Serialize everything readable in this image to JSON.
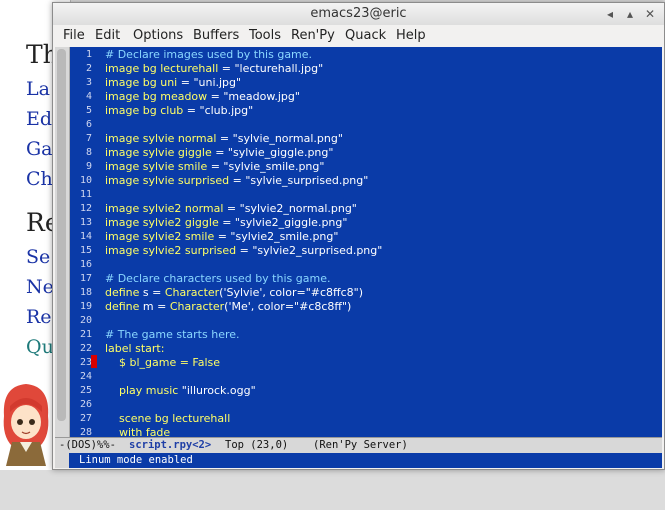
{
  "background_window": {
    "lines": [
      "Th",
      "La",
      "Ed",
      "Ga",
      "Ch",
      "Re",
      "Se",
      "Ne",
      "Re",
      "Qu"
    ]
  },
  "window": {
    "title": "emacs23@eric",
    "controls": [
      "◂",
      "▴",
      "✕"
    ]
  },
  "menu": [
    "File",
    "Edit",
    "Options",
    "Buffers",
    "Tools",
    "Ren'Py",
    "Quack",
    "Help"
  ],
  "line_numbers": [
    "1",
    "2",
    "3",
    "4",
    "5",
    "6",
    "7",
    "8",
    "9",
    "10",
    "11",
    "12",
    "13",
    "14",
    "15",
    "16",
    "17",
    "18",
    "19",
    "20",
    "21",
    "22",
    "23",
    "24",
    "25",
    "26",
    "27",
    "28"
  ],
  "code": [
    [
      {
        "t": "# Declare images used by this game.",
        "c": "cm"
      }
    ],
    [
      {
        "t": "image",
        "c": "kw"
      },
      {
        "t": " bg lecturehall",
        "c": "kw"
      },
      {
        "t": " = \"lecturehall.jpg\"",
        "c": "st"
      }
    ],
    [
      {
        "t": "image",
        "c": "kw"
      },
      {
        "t": " bg uni",
        "c": "kw"
      },
      {
        "t": " = \"uni.jpg\"",
        "c": "st"
      }
    ],
    [
      {
        "t": "image",
        "c": "kw"
      },
      {
        "t": " bg meadow",
        "c": "kw"
      },
      {
        "t": " = \"meadow.jpg\"",
        "c": "st"
      }
    ],
    [
      {
        "t": "image",
        "c": "kw"
      },
      {
        "t": " bg club",
        "c": "kw"
      },
      {
        "t": " = \"club.jpg\"",
        "c": "st"
      }
    ],
    [],
    [
      {
        "t": "image",
        "c": "kw"
      },
      {
        "t": " sylvie normal",
        "c": "kw"
      },
      {
        "t": " = \"sylvie_normal.png\"",
        "c": "st"
      }
    ],
    [
      {
        "t": "image",
        "c": "kw"
      },
      {
        "t": " sylvie giggle",
        "c": "kw"
      },
      {
        "t": " = \"sylvie_giggle.png\"",
        "c": "st"
      }
    ],
    [
      {
        "t": "image",
        "c": "kw"
      },
      {
        "t": " sylvie smile",
        "c": "kw"
      },
      {
        "t": " = \"sylvie_smile.png\"",
        "c": "st"
      }
    ],
    [
      {
        "t": "image",
        "c": "kw"
      },
      {
        "t": " sylvie surprised",
        "c": "kw"
      },
      {
        "t": " = \"sylvie_surprised.png\"",
        "c": "st"
      }
    ],
    [],
    [
      {
        "t": "image",
        "c": "kw"
      },
      {
        "t": " sylvie2 normal",
        "c": "kw"
      },
      {
        "t": " = \"sylvie2_normal.png\"",
        "c": "st"
      }
    ],
    [
      {
        "t": "image",
        "c": "kw"
      },
      {
        "t": " sylvie2 giggle",
        "c": "kw"
      },
      {
        "t": " = \"sylvie2_giggle.png\"",
        "c": "st"
      }
    ],
    [
      {
        "t": "image",
        "c": "kw"
      },
      {
        "t": " sylvie2 smile",
        "c": "kw"
      },
      {
        "t": " = \"sylvie2_smile.png\"",
        "c": "st"
      }
    ],
    [
      {
        "t": "image",
        "c": "kw"
      },
      {
        "t": " sylvie2 surprised",
        "c": "kw"
      },
      {
        "t": " = \"sylvie2_surprised.png\"",
        "c": "st"
      }
    ],
    [],
    [
      {
        "t": "# Declare characters used by this game.",
        "c": "cm"
      }
    ],
    [
      {
        "t": "define",
        "c": "kw"
      },
      {
        "t": " s = ",
        "c": "nm"
      },
      {
        "t": "Character",
        "c": "kw"
      },
      {
        "t": "('Sylvie', color=\"#c8ffc8\")",
        "c": "st"
      }
    ],
    [
      {
        "t": "define",
        "c": "kw"
      },
      {
        "t": " m = ",
        "c": "nm"
      },
      {
        "t": "Character",
        "c": "kw"
      },
      {
        "t": "('Me', color=\"#c8c8ff\")",
        "c": "st"
      }
    ],
    [],
    [
      {
        "t": "# The game starts here.",
        "c": "cm"
      }
    ],
    [
      {
        "t": "label",
        "c": "kw"
      },
      {
        "t": " start:",
        "c": "kw"
      }
    ],
    [
      {
        "t": "    $ bl_game = False",
        "c": "kw"
      }
    ],
    [],
    [
      {
        "t": "    play music",
        "c": "kw"
      },
      {
        "t": " \"illurock.ogg\"",
        "c": "st"
      }
    ],
    [],
    [
      {
        "t": "    scene bg lecturehall",
        "c": "kw"
      }
    ],
    [
      {
        "t": "    with fade",
        "c": "kw"
      }
    ]
  ],
  "modeline": {
    "prefix": "-(DOS)%%-",
    "buffer": "script.rpy<2>",
    "position": "Top (23,0)",
    "mode": "(Ren'Py Server)"
  },
  "minibuffer": "Linum mode enabled"
}
